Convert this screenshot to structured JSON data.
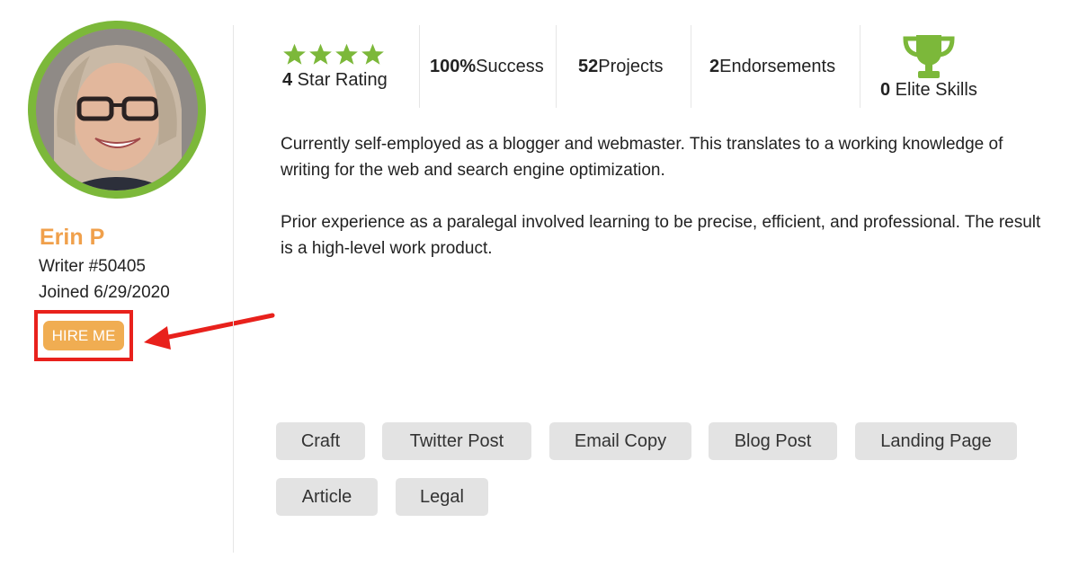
{
  "profile": {
    "name": "Erin P",
    "writer_id": "Writer #50405",
    "joined": "Joined 6/29/2020",
    "hire_label": "HIRE ME"
  },
  "stats": {
    "rating_value": "4",
    "rating_label": " Star Rating",
    "rating_stars": 4,
    "success_value": "100%",
    "success_label": " Success",
    "projects_value": "52",
    "projects_label": " Projects",
    "endorsements_value": "2",
    "endorsements_label": " Endorsements",
    "elite_value": "0",
    "elite_label": " Elite Skills"
  },
  "bio": {
    "paragraph1": "Currently self-employed as a blogger and webmaster. This translates to a working knowledge of writing for the web and search engine optimization.",
    "paragraph2": "Prior experience as a paralegal involved learning to be precise, efficient, and professional. The result is a high-level work product."
  },
  "tags": [
    "Craft",
    "Twitter Post",
    "Email Copy",
    "Blog Post",
    "Landing Page",
    "Article",
    "Legal"
  ],
  "colors": {
    "accent_green": "#7cb83a",
    "accent_orange": "#f0a04b",
    "highlight_red": "#e8211c"
  },
  "icons": {
    "star": "star-icon",
    "trophy": "trophy-icon",
    "arrow": "annotation-arrow"
  }
}
